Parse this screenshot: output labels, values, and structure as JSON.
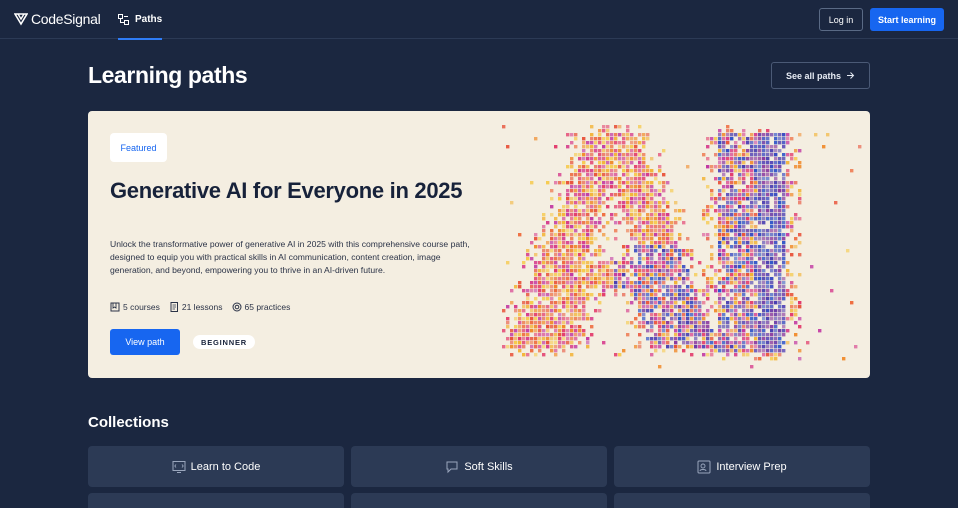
{
  "nav": {
    "logo_text": "CodeSignal",
    "tab_label": "Paths",
    "login_label": "Log in",
    "start_label": "Start learning",
    "accent_color": "#1766f0"
  },
  "header": {
    "title": "Learning paths",
    "see_all_label": "See all paths"
  },
  "featured": {
    "badge": "Featured",
    "title": "Generative AI for Everyone in 2025",
    "description": "Unlock the transformative power of generative AI in 2025 with this comprehensive course path, designed to equip you with practical skills in AI communication, content creation, image generation, and beyond, empowering you to thrive in an AI-driven future.",
    "courses": "5 courses",
    "lessons": "21 lessons",
    "practices": "65 practices",
    "view_label": "View path",
    "level": "BEGINNER",
    "art_icon": "ai-pixel-art"
  },
  "collections": {
    "title": "Collections",
    "items": [
      {
        "label": "Learn to Code",
        "icon": "code-icon"
      },
      {
        "label": "Soft Skills",
        "icon": "chat-icon"
      },
      {
        "label": "Interview Prep",
        "icon": "interview-icon"
      }
    ]
  }
}
